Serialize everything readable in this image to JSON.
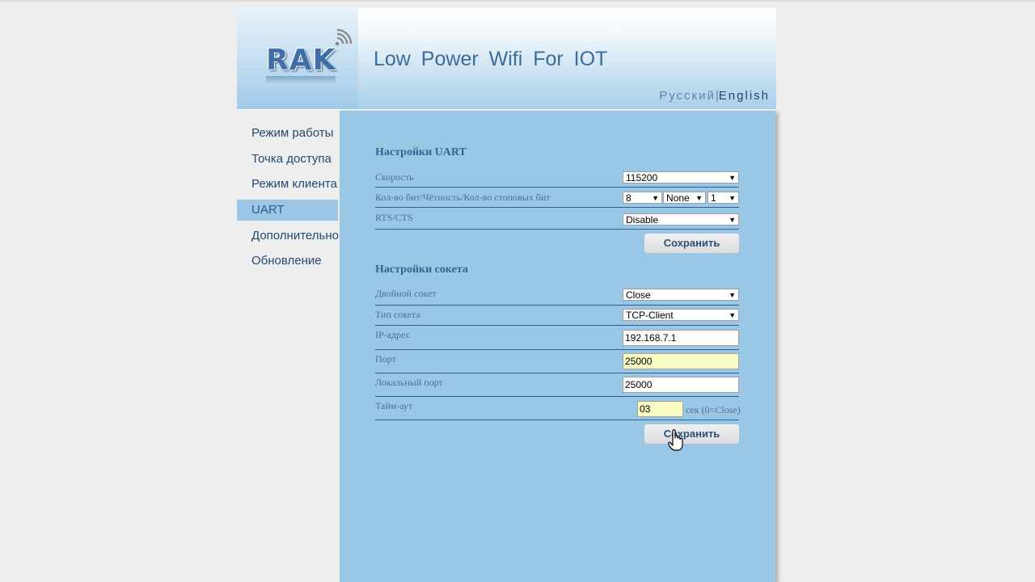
{
  "header": {
    "logo_text": "RAK",
    "title": "Low Power Wifi For IOT",
    "languages": [
      "Русский",
      "English"
    ],
    "separator": "|",
    "active_language": "English"
  },
  "sidebar": {
    "items": [
      {
        "label": "Режим работы"
      },
      {
        "label": "Точка доступа"
      },
      {
        "label": "Режим клиента"
      },
      {
        "label": "UART"
      },
      {
        "label": "Дополнительно"
      },
      {
        "label": "Обновление"
      }
    ],
    "active": "UART"
  },
  "uart": {
    "title": "Настройки UART",
    "speed": {
      "label": "Скорость",
      "value": "115200"
    },
    "format": {
      "label": "Кол-во бит/Чётность/Кол-во стоповых бит",
      "bits": "8",
      "parity": "None",
      "stop_bits": "1"
    },
    "rtscts": {
      "label": "RTS/CTS",
      "value": "Disable"
    },
    "save_label": "Сохранить"
  },
  "socket": {
    "title": "Настройки сокета",
    "dual": {
      "label": "Двойной сокет",
      "value": "Close"
    },
    "type": {
      "label": "Тип сокета",
      "value": "TCP-Client"
    },
    "ip": {
      "label": "IP-адрес",
      "value": "192.168.7.1"
    },
    "port": {
      "label": "Порт",
      "value": "25000"
    },
    "local_port": {
      "label": "Локальный порт",
      "value": "25000"
    },
    "timeout": {
      "label": "Тайм-аут",
      "value": "03",
      "unit": "сек (0=Close)"
    },
    "save_label": "Сохранить"
  },
  "colors": {
    "panel_bg": "#9ac7e5",
    "page_bg": "#eeeeee",
    "accent_text": "#37638f",
    "input_highlight": "#fbfbc4"
  },
  "icons": [
    "wifi-signal-icon",
    "dropdown-arrow-icon",
    "hand-pointer-cursor-icon"
  ]
}
